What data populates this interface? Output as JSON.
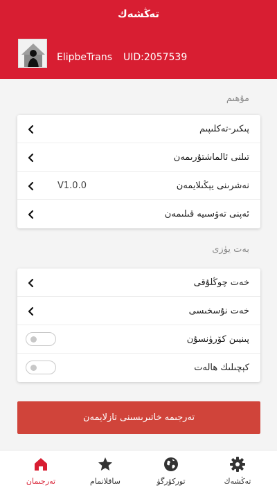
{
  "header": {
    "title": "تەڭشەك"
  },
  "user": {
    "name": "ElipbeTrans",
    "uid": "UID:2057539"
  },
  "sections": {
    "general": {
      "label": "مۇھىم",
      "items": [
        {
          "label": "پىكىر-تەكلىپىم",
          "value": ""
        },
        {
          "label": "تىلنى ئالماشتۇرىمەن",
          "value": ""
        },
        {
          "label": "نەشرىنى يېڭىلايمەن",
          "value": "V1.0.0"
        },
        {
          "label": "ئەپنى تەۋسىيە قىلىمەن",
          "value": ""
        }
      ]
    },
    "display": {
      "label": "بەت يۈزى",
      "items": [
        {
          "label": "خەت چوڭلۇقى"
        },
        {
          "label": "خەت نۇسخىسى"
        },
        {
          "label": "پىنيىن كۆرۈنسۇن",
          "toggle": false
        },
        {
          "label": "كېچىلىك ھالەت",
          "toggle": false
        }
      ]
    }
  },
  "cta": {
    "label": "تەرجىمە خاتىرىسىنى تازلايمەن"
  },
  "tabs": [
    {
      "label": "تەرجىمان",
      "icon": "home-icon",
      "active": true
    },
    {
      "label": "ساقلانمام",
      "icon": "star-icon",
      "active": false
    },
    {
      "label": "توركۆرگۈ",
      "icon": "globe-icon",
      "active": false
    },
    {
      "label": "تەڭشەك",
      "icon": "gear-icon",
      "active": false
    }
  ],
  "colors": {
    "header": "#d81e32",
    "cta": "#d0443a",
    "active_tab": "#d81e32"
  }
}
